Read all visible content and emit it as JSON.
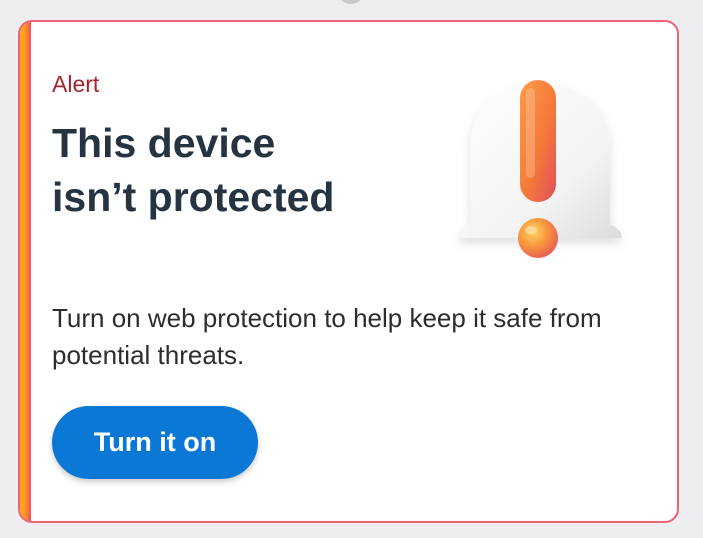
{
  "card": {
    "alert_label": "Alert",
    "title_line1": "This device",
    "title_line2": "isn’t protected",
    "description": "Turn on web protection to help keep it safe from potential threats.",
    "button_label": "Turn it on",
    "illustration_icon": "bell-exclamation-icon"
  },
  "colors": {
    "card_border": "#ee6276",
    "accent_left": "#ffb020",
    "alert_label": "#a4262c",
    "title": "#263442",
    "button_bg": "#0a78d4",
    "button_text": "#ffffff"
  }
}
